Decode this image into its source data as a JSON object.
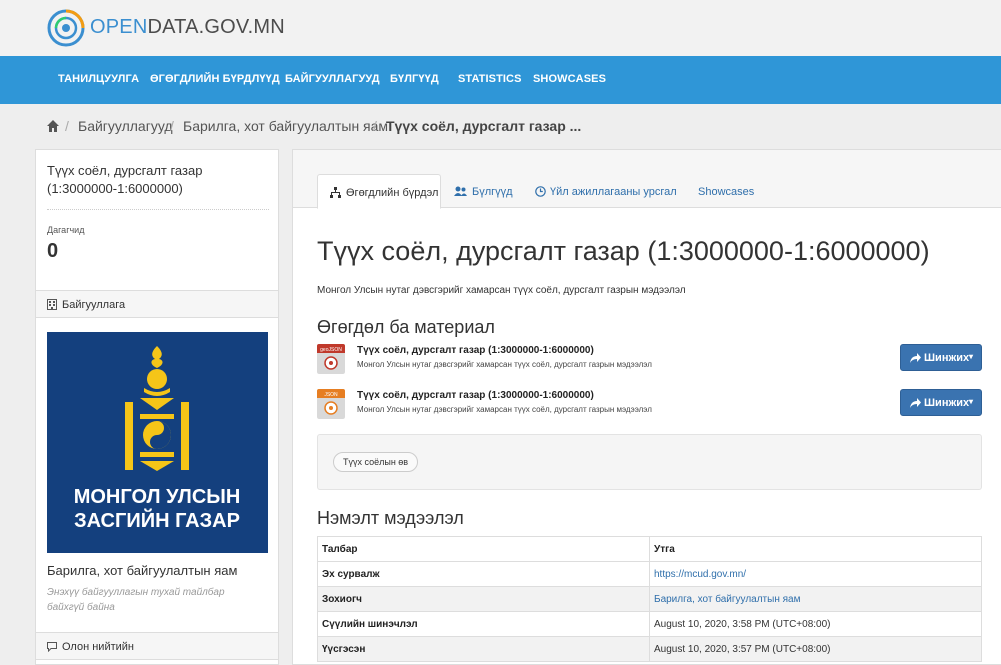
{
  "header": {
    "logo_prefix": "OPEN",
    "logo_suffix": "DATA.GOV.MN",
    "nav": [
      "ТАНИЛЦУУЛГА",
      "ӨГӨГДЛИЙН БҮРДЛҮҮД",
      "БАЙГУУЛЛАГУУД",
      "БҮЛГҮҮД",
      "STATISTICS",
      "SHOWCASES"
    ]
  },
  "breadcrumb": {
    "items": [
      "Байгууллагууд",
      "Барилга, хот байгуулалтын яам",
      "Түүх соёл, дурсгалт газар ..."
    ],
    "separator": "/"
  },
  "sidebar": {
    "title": "Түүх соёл, дурсгалт газар (1:3000000-1:6000000)",
    "followers_label": "Дагагчид",
    "followers_count": "0",
    "org_section_label": "Байгууллага",
    "org_logo_line1": "МОНГОЛ УЛСЫН",
    "org_logo_line2": "ЗАСГИЙН ГАЗАР",
    "org_name": "Барилга, хот байгуулалтын яам",
    "org_description": "Энэхүү байгууллагын тухай тайлбар байхгүй байна",
    "license_section_label": "Олон нийтийн"
  },
  "tabs": [
    {
      "label": "Өгөгдлийн бүрдэл",
      "icon": "sitemap-icon",
      "active": true
    },
    {
      "label": "Бүлгүүд",
      "icon": "users-icon",
      "active": false
    },
    {
      "label": "Үйл ажиллагааны урсгал",
      "icon": "clock-icon",
      "active": false
    },
    {
      "label": "Showcases",
      "icon": "",
      "active": false
    }
  ],
  "dataset": {
    "title": "Түүх соёл, дурсгалт газар (1:3000000-1:6000000)",
    "notes": "Монгол Улсын нутаг дэвсгэрийг хамарсан түүх соёл, дурсгалт газрын мэдээлэл",
    "resources_heading": "Өгөгдөл ба материал",
    "resources": [
      {
        "format": "geoJSON",
        "format_color": "#c0392b",
        "title": "Түүх соёл, дурсгалт газар (1:3000000-1:6000000)",
        "description": "Монгол Улсын нутаг дэвсгэрийг хамарсан түүх соёл, дурсгалт газрын мэдээлэл",
        "button": "Шинжих"
      },
      {
        "format": "JSON",
        "format_color": "#e67e22",
        "title": "Түүх соёл, дурсгалт газар (1:3000000-1:6000000)",
        "description": "Монгол Улсын нутаг дэвсгэрийг хамарсан түүх соёл, дурсгалт газрын мэдээлэл",
        "button": "Шинжих"
      }
    ],
    "tags": [
      "Түүх соёлын өв"
    ],
    "additional_heading": "Нэмэлт мэдээлэл",
    "table": {
      "headers": [
        "Талбар",
        "Утга"
      ],
      "rows": [
        {
          "key": "Эх сурвалж",
          "value": "https://mcud.gov.mn/",
          "link": true
        },
        {
          "key": "Зохиогч",
          "value": "Барилга, хот байгуулалтын яам",
          "link": true
        },
        {
          "key": "Сүүлийн шинэчлэл",
          "value": "August 10, 2020, 3:58 PM (UTC+08:00)",
          "link": false
        },
        {
          "key": "Үүсгэсэн",
          "value": "August 10, 2020, 3:57 PM (UTC+08:00)",
          "link": false
        }
      ]
    }
  },
  "colors": {
    "navbar": "#2f96d7",
    "link": "#2f6fab",
    "button": "#3a73b0",
    "org_bg": "#14407e",
    "soyombo": "#f5c518"
  }
}
